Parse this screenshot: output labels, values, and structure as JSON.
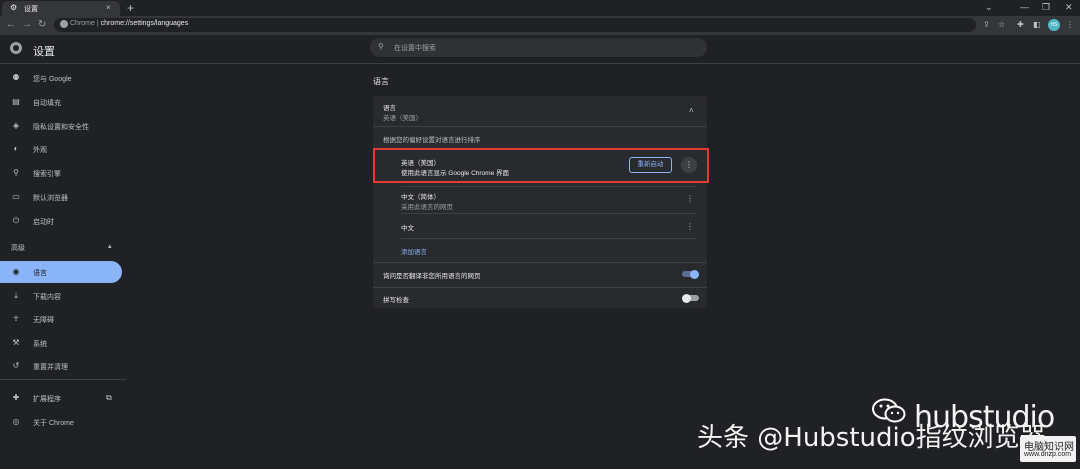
{
  "browser": {
    "tab_title": "设置",
    "tab_close": "×",
    "new_tab": "+",
    "url_origin": "Chrome",
    "url_separator": "|",
    "url_path": "chrome://settings/languages",
    "avatar_text": "HS"
  },
  "header": {
    "title": "设置",
    "search_placeholder": "在设置中搜索"
  },
  "sidebar": {
    "items": [
      {
        "icon": "person-icon",
        "glyph": "⚉",
        "label": "您与 Google"
      },
      {
        "icon": "clipboard-icon",
        "glyph": "▤",
        "label": "自动填充"
      },
      {
        "icon": "shield-icon",
        "glyph": "◈",
        "label": "隐私设置和安全性"
      },
      {
        "icon": "palette-icon",
        "glyph": "◐",
        "label": "外观"
      },
      {
        "icon": "search-icon",
        "glyph": "⚲",
        "label": "搜索引擎"
      },
      {
        "icon": "browser-icon",
        "glyph": "▭",
        "label": "默认浏览器"
      },
      {
        "icon": "power-icon",
        "glyph": "⏻",
        "label": "启动时"
      }
    ],
    "advanced_label": "高级",
    "advanced_items": [
      {
        "icon": "globe-icon",
        "glyph": "◉",
        "label": "语言"
      },
      {
        "icon": "download-icon",
        "glyph": "⤓",
        "label": "下载内容"
      },
      {
        "icon": "accessibility-icon",
        "glyph": "☥",
        "label": "无障碍"
      },
      {
        "icon": "wrench-icon",
        "glyph": "⚒",
        "label": "系统"
      },
      {
        "icon": "history-icon",
        "glyph": "↺",
        "label": "重置并清理"
      }
    ],
    "extensions_label": "扩展程序",
    "about_label": "关于 Chrome"
  },
  "main": {
    "section_title": "语言",
    "language_header": "语言",
    "language_sub": "英语（美国）",
    "order_note": "根据您的偏好设置对语言进行排序",
    "languages": [
      {
        "name": "英语（美国）",
        "desc": "使用此语言显示 Google Chrome 界面",
        "button": "重新启动"
      },
      {
        "name": "中文（简体）",
        "desc": "采用此语言的网页"
      },
      {
        "name": "中文",
        "desc": ""
      }
    ],
    "add_languages": "添加语言",
    "translate_offer": "询问是否翻译非您所用语言的网页",
    "spellcheck": "拼写检查",
    "translate_on": true,
    "spellcheck_on": false
  },
  "watermark": {
    "brand": "hubstudio",
    "line": "头条 @Hubstudio指纹浏览器",
    "site_top": "电脑知识网",
    "site_bottom": "www.dnzp.com"
  },
  "colors": {
    "accent": "#8ab4f8",
    "highlight_border": "#e53935",
    "background": "#202124",
    "card": "#292a2d"
  }
}
